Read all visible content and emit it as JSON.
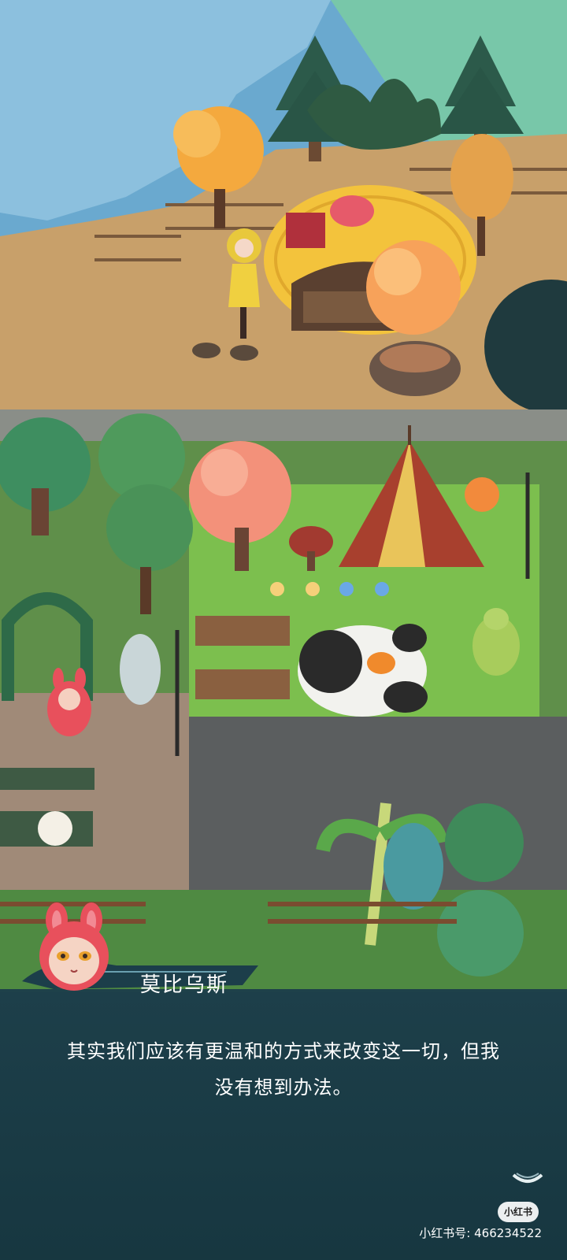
{
  "dialog": {
    "speaker": "莫比乌斯",
    "line1": "其实我们应该有更温和的方式来改变这一切，但我",
    "line2": "没有想到办法。"
  },
  "watermark": {
    "badge": "小红书",
    "id_text": "小红书号: 466234522"
  },
  "icons": {
    "avatar": "red-rabbit-hood-character-icon",
    "next": "continue-chevron-icon"
  },
  "colors": {
    "dialog_bg": "#1c3e4a",
    "speaker_accent": "#2a5a6a",
    "sky": "#7fb6d6",
    "dirt": "#c49a62",
    "grass": "#5f9a4a",
    "stone": "#5a5f60"
  }
}
